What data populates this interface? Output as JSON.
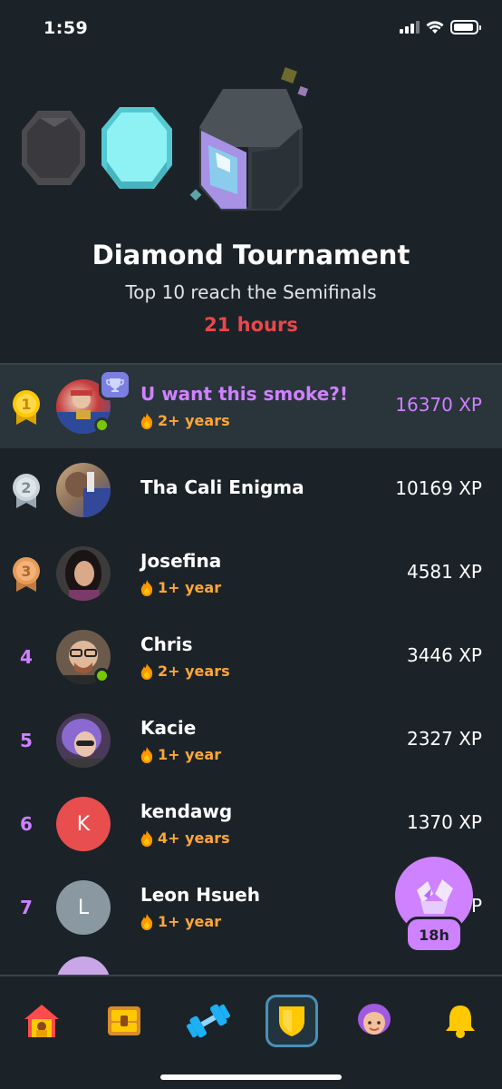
{
  "status_bar": {
    "time": "1:59",
    "battery_level": 0.9
  },
  "header": {
    "title": "Diamond Tournament",
    "subtitle": "Top 10 reach the Semifinals",
    "time_left": "21 hours",
    "league_icons": [
      "obsidian-league-icon",
      "diamond-league-icon",
      "tournament-cube-icon"
    ]
  },
  "leaderboard": [
    {
      "rank": "1",
      "medal": "gold",
      "name": "U want this smoke?!",
      "streak": "2+ years",
      "xp": "16370 XP",
      "is_current_user": true,
      "online": true,
      "avatar": "photo"
    },
    {
      "rank": "2",
      "medal": "silver",
      "name": "Tha Cali Enigma",
      "streak": "",
      "xp": "10169 XP",
      "online": false,
      "avatar": "photo"
    },
    {
      "rank": "3",
      "medal": "bronze",
      "name": "Josefina",
      "streak": "1+ year",
      "xp": "4581 XP",
      "online": false,
      "avatar": "photo"
    },
    {
      "rank": "4",
      "name": "Chris",
      "streak": "2+ years",
      "xp": "3446 XP",
      "online": true,
      "avatar": "photo"
    },
    {
      "rank": "5",
      "name": "Kacie",
      "streak": "1+ year",
      "xp": "2327 XP",
      "online": false,
      "avatar": "photo"
    },
    {
      "rank": "6",
      "name": "kendawg",
      "streak": "4+ years",
      "xp": "1370 XP",
      "online": false,
      "avatar": "K",
      "avatar_color": "#e84e4e"
    },
    {
      "rank": "7",
      "name": "Leon Hsueh",
      "streak": "1+ year",
      "xp": "P",
      "online": false,
      "avatar": "L",
      "avatar_color": "#8a98a2"
    }
  ],
  "floating_button": {
    "timer": "18h",
    "icon": "chest-icon"
  },
  "bottom_nav": [
    "home-icon",
    "chest-icon",
    "dumbbell-icon",
    "shield-icon",
    "profile-icon",
    "bell-icon"
  ],
  "colors": {
    "accent": "#ce82ff",
    "timer_red": "#e8484c",
    "streak": "#ffa63a",
    "background": "#1b2328"
  }
}
